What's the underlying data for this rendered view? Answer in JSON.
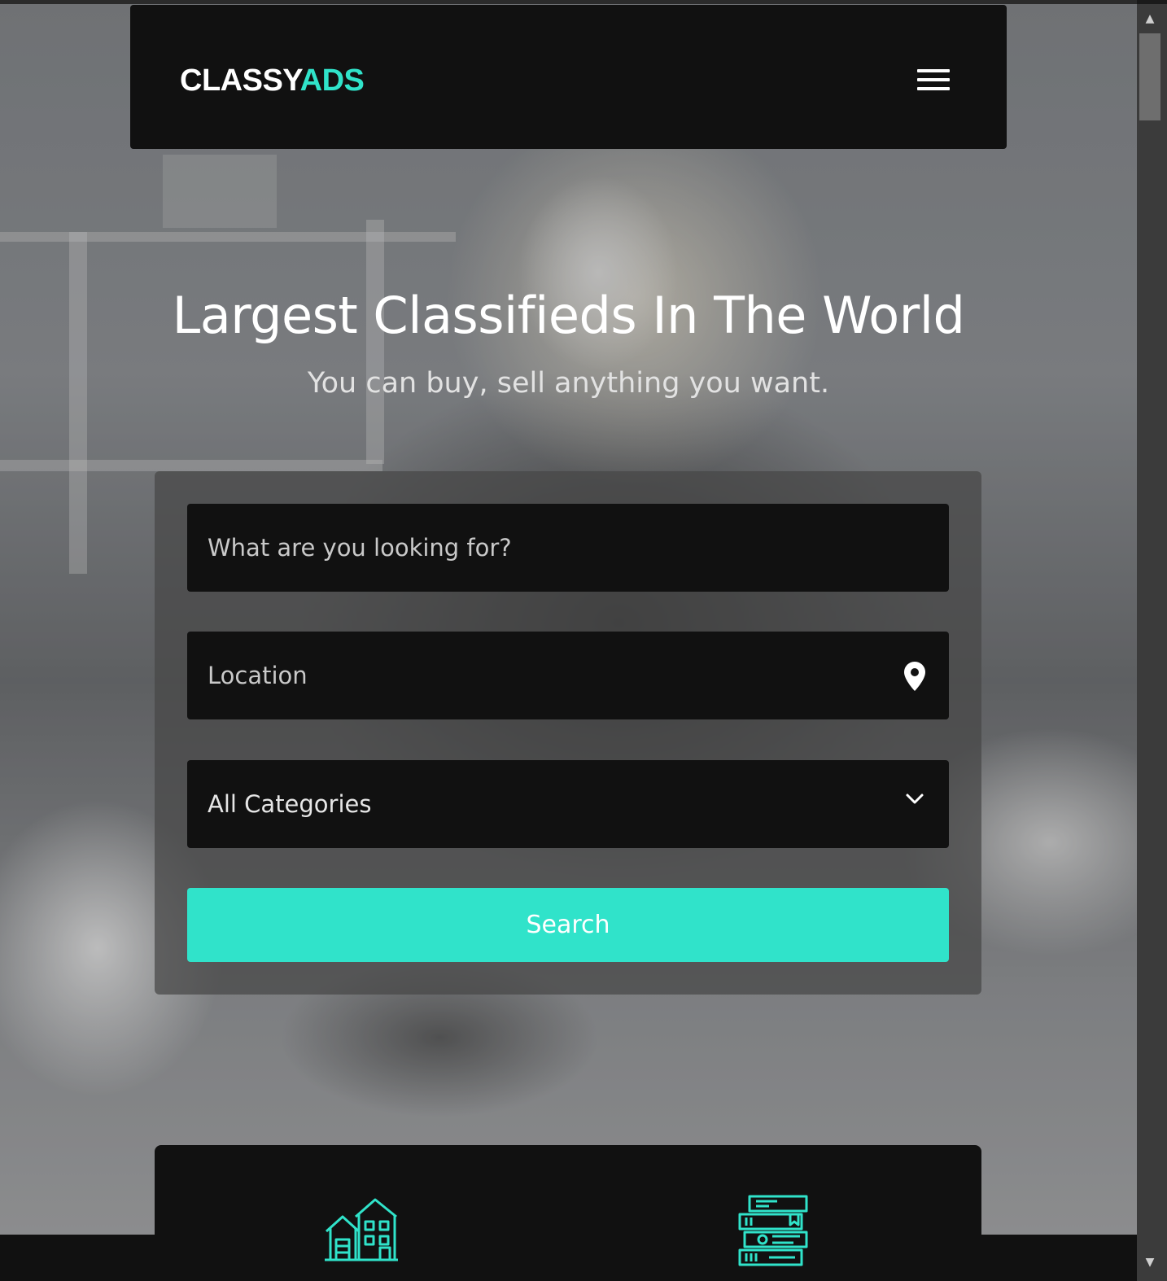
{
  "navbar": {
    "logo_primary": "CLASSY",
    "logo_accent": "ADS",
    "menu_icon": "hamburger-menu-icon"
  },
  "hero": {
    "title": "Largest Classifieds In The World",
    "subtitle": "You can buy, sell anything you want."
  },
  "search": {
    "keyword_placeholder": "What are you looking for?",
    "location_placeholder": "Location",
    "location_icon": "map-pin-icon",
    "category_selected": "All Categories",
    "category_icon": "chevron-down-icon",
    "button_label": "Search"
  },
  "categories": {
    "icons": [
      "real-estate-house-icon",
      "books-icon"
    ]
  },
  "colors": {
    "accent": "#30e3ca",
    "dark": "#111111",
    "text": "#ffffff"
  }
}
